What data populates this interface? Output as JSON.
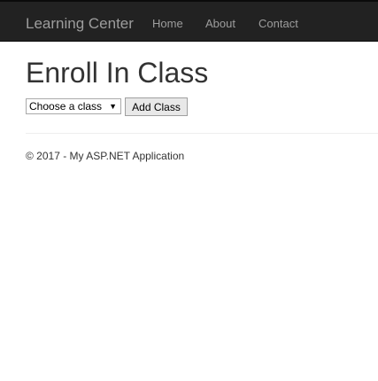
{
  "navbar": {
    "brand": "Learning Center",
    "links": [
      "Home",
      "About",
      "Contact"
    ]
  },
  "main": {
    "title": "Enroll In Class",
    "select": {
      "selected": "Choose a class",
      "arrow": "▼"
    },
    "add_button": "Add Class"
  },
  "footer": {
    "text": "© 2017 - My ASP.NET Application"
  },
  "colors": {
    "navbar_bg": "#222222",
    "nav_text": "#9d9d9d",
    "body_text": "#333333"
  }
}
